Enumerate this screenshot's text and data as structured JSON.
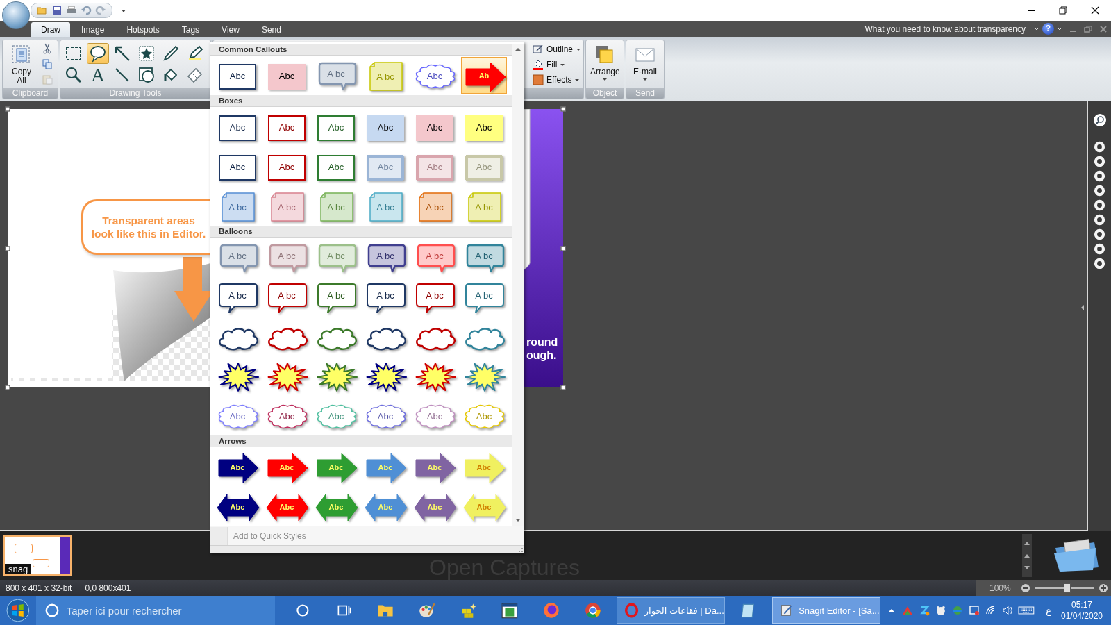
{
  "ribbon_tabs": [
    {
      "label": "Draw",
      "selected": true
    },
    {
      "label": "Image",
      "selected": false
    },
    {
      "label": "Hotspots",
      "selected": false
    },
    {
      "label": "Tags",
      "selected": false
    },
    {
      "label": "View",
      "selected": false
    },
    {
      "label": "Send",
      "selected": false
    }
  ],
  "help_link": "What you need to know about transparency",
  "help_glyph": "?",
  "clipboard": {
    "label": "Clipboard",
    "copy_all": "Copy All",
    "small_tools": [
      {
        "kind": "cut",
        "disabled": false
      },
      {
        "kind": "copy",
        "disabled": false
      },
      {
        "kind": "paste",
        "disabled": true
      }
    ]
  },
  "drawing_tools": {
    "label": "Drawing Tools",
    "tools": [
      {
        "kind": "select",
        "selected": false
      },
      {
        "kind": "callout",
        "selected": true
      },
      {
        "kind": "arrow",
        "selected": false
      },
      {
        "kind": "stamp",
        "selected": false
      },
      {
        "kind": "pen",
        "selected": false
      },
      {
        "kind": "highlight",
        "selected": false
      },
      {
        "kind": "magnify",
        "selected": false
      },
      {
        "kind": "text",
        "glyph": "A",
        "selected": false
      },
      {
        "kind": "line",
        "selected": false
      },
      {
        "kind": "shape",
        "selected": false
      },
      {
        "kind": "fill",
        "selected": false
      },
      {
        "kind": "erase",
        "selected": false
      }
    ]
  },
  "style_options": [
    {
      "kind": "outline",
      "label": "Outline"
    },
    {
      "kind": "fill",
      "label": "Fill"
    },
    {
      "kind": "effects",
      "label": "Effects"
    }
  ],
  "object_group": {
    "label": "Object",
    "button": "Arrange"
  },
  "send_group": {
    "label": "Send",
    "button": "E-mail"
  },
  "canvas": {
    "callout": "Transparent areas\nlook like this in Editor.",
    "caption_lines": [
      "round",
      "ough."
    ]
  },
  "gallery": {
    "sections": [
      {
        "title": "Common Callouts",
        "items": [
          {
            "kind": "box",
            "color": "#1f3864",
            "text": "Abc",
            "selected": false
          },
          {
            "kind": "flat",
            "color": "#f4c7cc",
            "text": "Abc",
            "selected": false
          },
          {
            "kind": "bubble",
            "color": "#8496b0",
            "text": "A bc",
            "selected": false
          },
          {
            "kind": "note",
            "color": "#c8c800",
            "text": "A bc",
            "selected": false
          },
          {
            "kind": "scallop",
            "color": "#6666ff",
            "text": "Abc",
            "selected": false
          },
          {
            "kind": "arrow",
            "color": "#ff0000",
            "text": "Ab",
            "selected": true
          }
        ]
      },
      {
        "title": "Boxes",
        "items": [
          {
            "kind": "box",
            "color": "#1f3864",
            "text": "Abc",
            "selected": false
          },
          {
            "kind": "box",
            "color": "#c00000",
            "text": "Abc",
            "selected": false
          },
          {
            "kind": "box",
            "color": "#2e7d32",
            "text": "Abc",
            "selected": false
          },
          {
            "kind": "flat",
            "color": "#c6d9f1",
            "text": "Abc",
            "selected": false
          },
          {
            "kind": "flat",
            "color": "#f4c7cc",
            "text": "Abc",
            "selected": false
          },
          {
            "kind": "flat",
            "color": "#ffff80",
            "text": "Abc",
            "selected": false
          },
          {
            "kind": "box",
            "color": "#1f3864",
            "text": "Abc",
            "selected": false
          },
          {
            "kind": "box",
            "color": "#c00000",
            "text": "Abc",
            "selected": false
          },
          {
            "kind": "box",
            "color": "#2e7d32",
            "text": "Abc",
            "selected": false
          },
          {
            "kind": "bevel",
            "color": "#9bb5d6",
            "text": "Abc",
            "selected": false
          },
          {
            "kind": "bevel",
            "color": "#d9a5ad",
            "text": "Abc",
            "selected": false
          },
          {
            "kind": "bevel",
            "color": "#c8c8a8",
            "text": "Abc",
            "selected": false
          },
          {
            "kind": "note",
            "color": "#558ed5",
            "text": "A bc",
            "selected": false
          },
          {
            "kind": "note",
            "color": "#d9818e",
            "text": "A bc",
            "selected": false
          },
          {
            "kind": "note",
            "color": "#77b255",
            "text": "A bc",
            "selected": false
          },
          {
            "kind": "note",
            "color": "#4bacc6",
            "text": "A bc",
            "selected": false
          },
          {
            "kind": "note",
            "color": "#e46c0a",
            "text": "A bc",
            "selected": false
          },
          {
            "kind": "note",
            "color": "#c8c800",
            "text": "A bc",
            "selected": false
          }
        ]
      },
      {
        "title": "Balloons",
        "items": [
          {
            "kind": "bubble",
            "color": "#8496b0",
            "text": "A bc",
            "selected": false
          },
          {
            "kind": "bubble",
            "color": "#c09aa0",
            "text": "A bc",
            "selected": false
          },
          {
            "kind": "bubble",
            "color": "#9cc08a",
            "text": "A bc",
            "selected": false
          },
          {
            "kind": "bubble",
            "color": "#403f8f",
            "text": "A bc",
            "selected": false
          },
          {
            "kind": "bubble",
            "color": "#ff4f4f",
            "text": "A bc",
            "selected": false
          },
          {
            "kind": "bubble",
            "color": "#31849b",
            "text": "A bc",
            "selected": false
          },
          {
            "kind": "speech",
            "color": "#1f3864",
            "text": "A bc",
            "selected": false
          },
          {
            "kind": "speech",
            "color": "#c00000",
            "text": "A bc",
            "selected": false
          },
          {
            "kind": "speech",
            "color": "#3c7a2a",
            "text": "A bc",
            "selected": false
          },
          {
            "kind": "speech",
            "color": "#1f3864",
            "text": "A bc",
            "selected": false
          },
          {
            "kind": "speech",
            "color": "#c00000",
            "text": "A bc",
            "selected": false
          },
          {
            "kind": "speech",
            "color": "#31849b",
            "text": "A bc",
            "selected": false
          },
          {
            "kind": "cloud",
            "color": "#1f3864",
            "selected": false
          },
          {
            "kind": "cloud",
            "color": "#c00000",
            "selected": false
          },
          {
            "kind": "cloud",
            "color": "#3c7a2a",
            "selected": false
          },
          {
            "kind": "cloud",
            "color": "#1f3864",
            "selected": false
          },
          {
            "kind": "cloud",
            "color": "#c00000",
            "selected": false
          },
          {
            "kind": "cloud",
            "color": "#31849b",
            "selected": false
          },
          {
            "kind": "burst",
            "color": "#000080",
            "selected": false
          },
          {
            "kind": "burst",
            "color": "#d00000",
            "selected": false
          },
          {
            "kind": "burst",
            "color": "#3c7a2a",
            "selected": false
          },
          {
            "kind": "burst",
            "color": "#000080",
            "selected": false
          },
          {
            "kind": "burst",
            "color": "#d00000",
            "selected": false
          },
          {
            "kind": "burst",
            "color": "#31849b",
            "selected": false
          },
          {
            "kind": "scallop",
            "color": "#7f7fff",
            "text": "Abc",
            "selected": false
          },
          {
            "kind": "scallop",
            "color": "#c0305f",
            "text": "Abc",
            "selected": false
          },
          {
            "kind": "scallop",
            "color": "#4fc0a0",
            "text": "Abc",
            "selected": false
          },
          {
            "kind": "scallop",
            "color": "#6f6fdf",
            "text": "Abc",
            "selected": false
          },
          {
            "kind": "scallop",
            "color": "#c090c0",
            "text": "Abc",
            "selected": false
          },
          {
            "kind": "scallop",
            "color": "#e6c800",
            "text": "Abc",
            "selected": false
          }
        ]
      },
      {
        "title": "Arrows",
        "items": [
          {
            "kind": "arrow",
            "color": "#000080",
            "text": "Abc",
            "selected": false
          },
          {
            "kind": "arrow",
            "color": "#ff0000",
            "text": "Abc",
            "selected": false
          },
          {
            "kind": "arrow",
            "color": "#2e9d32",
            "text": "Abc",
            "selected": false
          },
          {
            "kind": "arrow",
            "color": "#4f8fd5",
            "text": "Abc",
            "selected": false
          },
          {
            "kind": "arrow",
            "color": "#8064a2",
            "text": "Abc",
            "selected": false
          },
          {
            "kind": "arrow",
            "color": "#f0f060",
            "text": "Abc",
            "selected": false
          },
          {
            "kind": "double",
            "color": "#000080",
            "text": "Abc",
            "selected": false
          },
          {
            "kind": "double",
            "color": "#ff0000",
            "text": "Abc",
            "selected": false
          },
          {
            "kind": "double",
            "color": "#2e9d32",
            "text": "Abc",
            "selected": false
          },
          {
            "kind": "double",
            "color": "#4f8fd5",
            "text": "Abc",
            "selected": false
          },
          {
            "kind": "double",
            "color": "#8064a2",
            "text": "Abc",
            "selected": false
          },
          {
            "kind": "double",
            "color": "#f0f060",
            "text": "Abc",
            "selected": false
          }
        ]
      }
    ],
    "footer": "Add to Quick Styles"
  },
  "tray": {
    "thumbnail_label": "snag",
    "empty_text": "Open Captures"
  },
  "status_bar": {
    "dimensions": "800 x 401 x 32-bit",
    "position": "0,0  800x401",
    "zoom": "100%",
    "zoom_slider": {
      "level": 0.55
    }
  },
  "taskbar": {
    "search_placeholder": "Taper ici pour rechercher",
    "windows": [
      {
        "kind": "opera",
        "title": "فقاعات الحوار | Da...",
        "active": false
      },
      {
        "kind": "snagit",
        "title": "Snagit Editor - [Sa...",
        "active": true
      }
    ],
    "ime": "ع",
    "time": "05:17",
    "date": "01/04/2020"
  }
}
